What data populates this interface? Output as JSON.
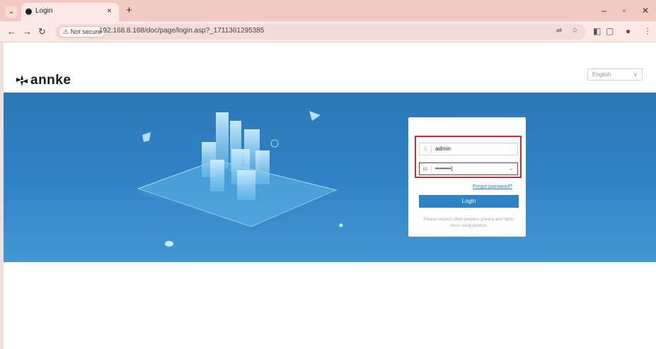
{
  "browser": {
    "tab_title": "Login",
    "tab_close": "×",
    "new_tab": "+",
    "minimize": "–",
    "restore": "▫",
    "close": "✕",
    "not_secure_label": "Not secure",
    "url": "192.168.8.168/doc/page/login.asp?_1711361295385",
    "icons": [
      "back-icon",
      "forward-icon",
      "reload-icon",
      "translate-icon",
      "star-icon",
      "extension-icon",
      "puzzle-icon",
      "profile-icon",
      "menu-icon"
    ]
  },
  "page": {
    "brand": "annke",
    "language": "English",
    "login": {
      "username_value": "admin",
      "password_value": "••••••••|",
      "forgot_password": "Forgot password?",
      "login_button": "Login",
      "notice": "Please respect other people's privacy and rights when using product."
    }
  },
  "colors": {
    "banner": "#2f82c6",
    "accent": "#2f82c6",
    "highlight": "#d72a2a"
  }
}
